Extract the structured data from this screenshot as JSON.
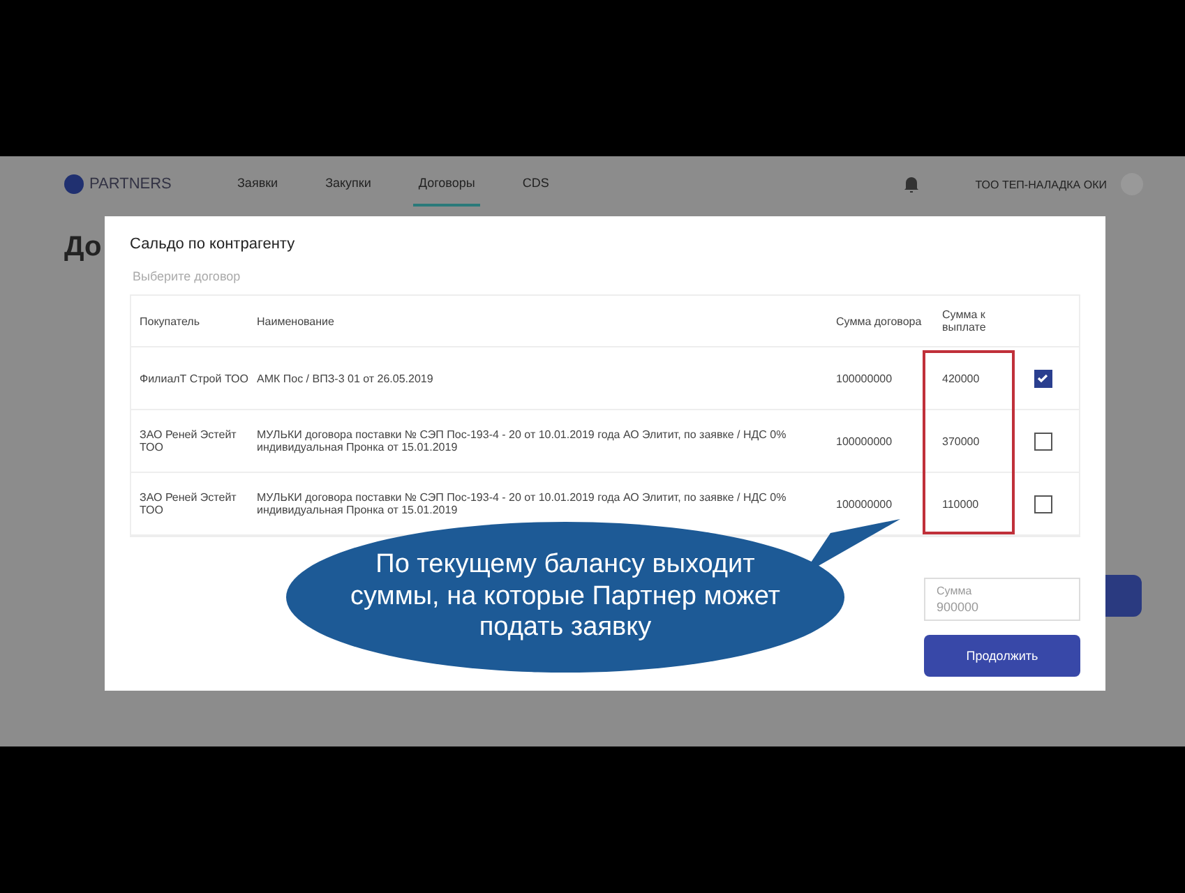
{
  "header": {
    "logo": "PARTNERS",
    "nav": [
      {
        "label": "Заявки",
        "selected": false
      },
      {
        "label": "Закупки",
        "selected": false
      },
      {
        "label": "Договоры",
        "selected": true
      },
      {
        "label": "CDS",
        "selected": false
      }
    ],
    "company": "ТОО ТЕП-НАЛАДКА ОКИ"
  },
  "page": {
    "title": "До"
  },
  "modal": {
    "title": "Сальдо по контрагенту",
    "select": {
      "placeholder": "Выберите договор"
    },
    "columns": [
      "Покупатель",
      "Наименование",
      "Сумма договора",
      "Сумма к выплате"
    ],
    "rows": [
      {
        "buyer": "ФилиалТ Строй ТОО",
        "name": "АМК Пос / ВПЗ-3 01 от 26.05.2019",
        "contract_sum": "100000000",
        "payout": "420000",
        "checked": true
      },
      {
        "buyer": "ЗАО Реней Эстейт ТОО",
        "name": "МУЛЬКИ договора поставки № СЭП Пос-193-4 - 20 от 10.01.2019 года АО Элитит, по заявке / НДС 0% индивидуальная Пронка от 15.01.2019",
        "contract_sum": "100000000",
        "payout": "370000",
        "checked": false
      },
      {
        "buyer": "ЗАО Реней Эстейт ТОО",
        "name": "МУЛЬКИ договора поставки № СЭП Пос-193-4 - 20 от 10.01.2019 года АО Элитит, по заявке / НДС 0% индивидуальная Пронка от 15.01.2019",
        "contract_sum": "100000000",
        "payout": "110000",
        "checked": false
      }
    ],
    "sum_field": {
      "label": "Сумма",
      "value": "900000"
    },
    "continue_button": "Продолжить"
  },
  "callout": {
    "text": "По текущему балансу выходит суммы, на которые Партнер может подать заявку"
  }
}
